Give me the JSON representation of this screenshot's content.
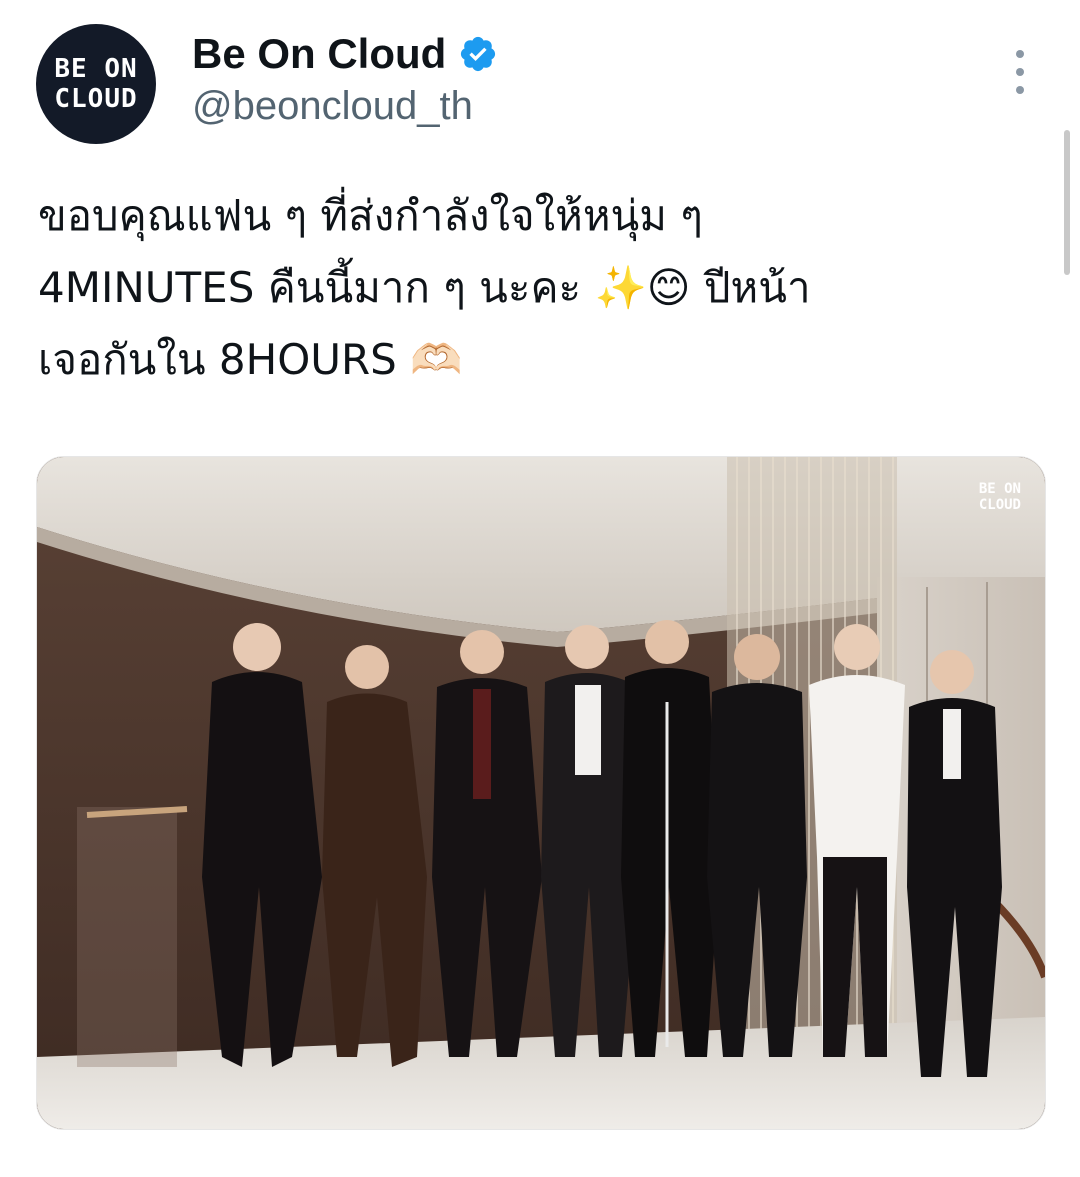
{
  "author": {
    "avatar_logo_text": "BE ON\nCLOUD",
    "display_name": "Be On Cloud",
    "handle": "@beoncloud_th",
    "verified_icon": "verified-badge-icon",
    "verified_color": "#1d9bf0"
  },
  "post": {
    "text_lines": [
      "ขอบคุณแฟน ๆ ที่ส่งกำลังใจให้หนุ่ม ๆ",
      "4MINUTES คืนนี้มาก ๆ นะคะ ✨😊 ปีหน้า",
      "เจอกันใน 8HOURS 🫶🏻"
    ]
  },
  "media": {
    "watermark_text": "BE ON\nCLOUD",
    "description_icon": "group-photo-image"
  },
  "menu": {
    "icon": "more-vertical-icon"
  },
  "colors": {
    "text_primary": "#0f1419",
    "text_secondary": "#536471",
    "avatar_bg": "#131a28",
    "accent": "#1d9bf0"
  }
}
